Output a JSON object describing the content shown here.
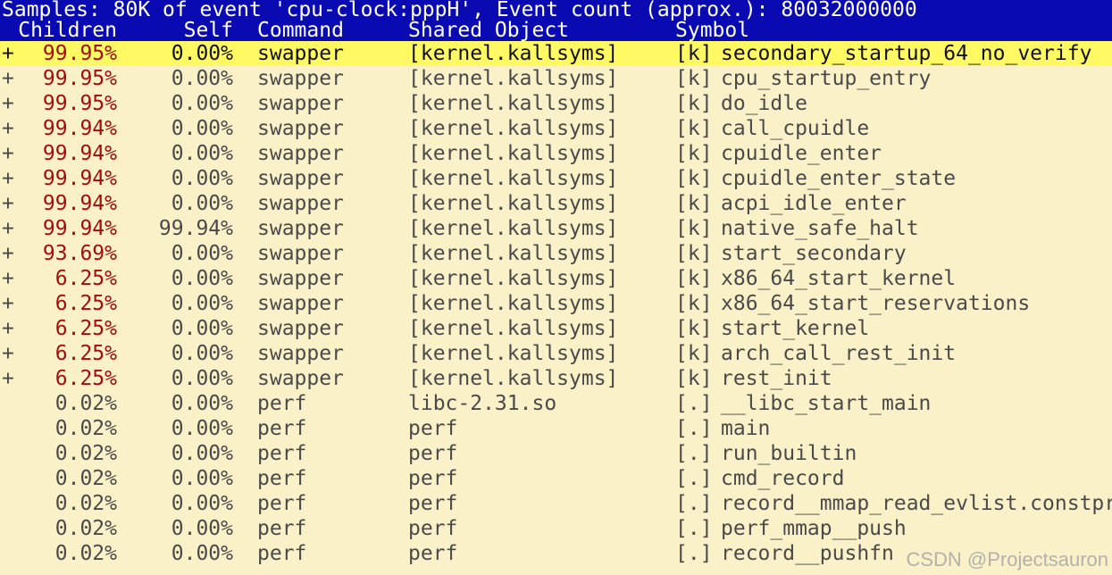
{
  "status_bar": "Samples: 80K of event 'cpu-clock:pppH', Event count (approx.): 80032000000",
  "columns": {
    "children": "Children",
    "self": "Self",
    "command": "Command",
    "shared_object": "Shared Object",
    "symbol": "Symbol"
  },
  "rows": [
    {
      "flag": "+",
      "children": "99.95%",
      "self": "0.00%",
      "command": "swapper",
      "shared_object": "[kernel.kallsyms]",
      "level": "[k]",
      "symbol": "secondary_startup_64_no_verify",
      "selected": true,
      "kind": "kernel",
      "children_hot": true,
      "self_hot": false
    },
    {
      "flag": "+",
      "children": "99.95%",
      "self": "0.00%",
      "command": "swapper",
      "shared_object": "[kernel.kallsyms]",
      "level": "[k]",
      "symbol": "cpu_startup_entry",
      "selected": false,
      "kind": "kernel",
      "children_hot": true,
      "self_hot": false
    },
    {
      "flag": "+",
      "children": "99.95%",
      "self": "0.00%",
      "command": "swapper",
      "shared_object": "[kernel.kallsyms]",
      "level": "[k]",
      "symbol": "do_idle",
      "selected": false,
      "kind": "kernel",
      "children_hot": true,
      "self_hot": false
    },
    {
      "flag": "+",
      "children": "99.94%",
      "self": "0.00%",
      "command": "swapper",
      "shared_object": "[kernel.kallsyms]",
      "level": "[k]",
      "symbol": "call_cpuidle",
      "selected": false,
      "kind": "kernel",
      "children_hot": true,
      "self_hot": false
    },
    {
      "flag": "+",
      "children": "99.94%",
      "self": "0.00%",
      "command": "swapper",
      "shared_object": "[kernel.kallsyms]",
      "level": "[k]",
      "symbol": "cpuidle_enter",
      "selected": false,
      "kind": "kernel",
      "children_hot": true,
      "self_hot": false
    },
    {
      "flag": "+",
      "children": "99.94%",
      "self": "0.00%",
      "command": "swapper",
      "shared_object": "[kernel.kallsyms]",
      "level": "[k]",
      "symbol": "cpuidle_enter_state",
      "selected": false,
      "kind": "kernel",
      "children_hot": true,
      "self_hot": false
    },
    {
      "flag": "+",
      "children": "99.94%",
      "self": "0.00%",
      "command": "swapper",
      "shared_object": "[kernel.kallsyms]",
      "level": "[k]",
      "symbol": "acpi_idle_enter",
      "selected": false,
      "kind": "kernel",
      "children_hot": true,
      "self_hot": false
    },
    {
      "flag": "+",
      "children": "99.94%",
      "self": "99.94%",
      "command": "swapper",
      "shared_object": "[kernel.kallsyms]",
      "level": "[k]",
      "symbol": "native_safe_halt",
      "selected": false,
      "kind": "kernel",
      "children_hot": true,
      "self_hot": true
    },
    {
      "flag": "+",
      "children": "93.69%",
      "self": "0.00%",
      "command": "swapper",
      "shared_object": "[kernel.kallsyms]",
      "level": "[k]",
      "symbol": "start_secondary",
      "selected": false,
      "kind": "kernel",
      "children_hot": true,
      "self_hot": false
    },
    {
      "flag": "+",
      "children": "6.25%",
      "self": "0.00%",
      "command": "swapper",
      "shared_object": "[kernel.kallsyms]",
      "level": "[k]",
      "symbol": "x86_64_start_kernel",
      "selected": false,
      "kind": "kernel",
      "children_hot": true,
      "self_hot": false
    },
    {
      "flag": "+",
      "children": "6.25%",
      "self": "0.00%",
      "command": "swapper",
      "shared_object": "[kernel.kallsyms]",
      "level": "[k]",
      "symbol": "x86_64_start_reservations",
      "selected": false,
      "kind": "kernel",
      "children_hot": true,
      "self_hot": false
    },
    {
      "flag": "+",
      "children": "6.25%",
      "self": "0.00%",
      "command": "swapper",
      "shared_object": "[kernel.kallsyms]",
      "level": "[k]",
      "symbol": "start_kernel",
      "selected": false,
      "kind": "kernel",
      "children_hot": true,
      "self_hot": false
    },
    {
      "flag": "+",
      "children": "6.25%",
      "self": "0.00%",
      "command": "swapper",
      "shared_object": "[kernel.kallsyms]",
      "level": "[k]",
      "symbol": "arch_call_rest_init",
      "selected": false,
      "kind": "kernel",
      "children_hot": true,
      "self_hot": false
    },
    {
      "flag": "+",
      "children": "6.25%",
      "self": "0.00%",
      "command": "swapper",
      "shared_object": "[kernel.kallsyms]",
      "level": "[k]",
      "symbol": "rest_init",
      "selected": false,
      "kind": "kernel",
      "children_hot": true,
      "self_hot": false
    },
    {
      "flag": "",
      "children": "0.02%",
      "self": "0.00%",
      "command": "perf",
      "shared_object": "libc-2.31.so",
      "level": "[.]",
      "symbol": "__libc_start_main",
      "selected": false,
      "kind": "user",
      "children_hot": false,
      "self_hot": false
    },
    {
      "flag": "",
      "children": "0.02%",
      "self": "0.00%",
      "command": "perf",
      "shared_object": "perf",
      "level": "[.]",
      "symbol": "main",
      "selected": false,
      "kind": "user",
      "children_hot": false,
      "self_hot": false
    },
    {
      "flag": "",
      "children": "0.02%",
      "self": "0.00%",
      "command": "perf",
      "shared_object": "perf",
      "level": "[.]",
      "symbol": "run_builtin",
      "selected": false,
      "kind": "user",
      "children_hot": false,
      "self_hot": false
    },
    {
      "flag": "",
      "children": "0.02%",
      "self": "0.00%",
      "command": "perf",
      "shared_object": "perf",
      "level": "[.]",
      "symbol": "cmd_record",
      "selected": false,
      "kind": "user",
      "children_hot": false,
      "self_hot": false
    },
    {
      "flag": "",
      "children": "0.02%",
      "self": "0.00%",
      "command": "perf",
      "shared_object": "perf",
      "level": "[.]",
      "symbol": "record__mmap_read_evlist.constprop",
      "selected": false,
      "kind": "user",
      "children_hot": false,
      "self_hot": false
    },
    {
      "flag": "",
      "children": "0.02%",
      "self": "0.00%",
      "command": "perf",
      "shared_object": "perf",
      "level": "[.]",
      "symbol": "perf_mmap__push",
      "selected": false,
      "kind": "user",
      "children_hot": false,
      "self_hot": false
    },
    {
      "flag": "",
      "children": "0.02%",
      "self": "0.00%",
      "command": "perf",
      "shared_object": "perf",
      "level": "[.]",
      "symbol": "record__pushfn",
      "selected": false,
      "kind": "user",
      "children_hot": false,
      "self_hot": false
    }
  ],
  "watermark": "CSDN @Projectsauron",
  "colors": {
    "status_bg": "#0a0ab2",
    "selection_bg": "#fffa64",
    "hot_value": "#a40d0d",
    "background": "#fbf1c9"
  }
}
